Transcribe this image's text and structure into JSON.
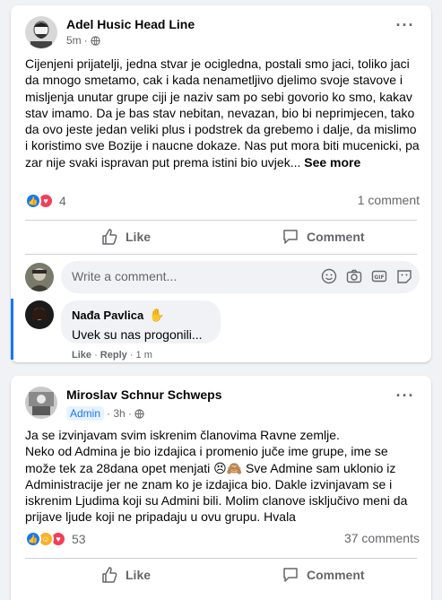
{
  "post1": {
    "author": "Adel Husic Head Line",
    "time": "5m",
    "body": "Cijenjeni prijatelji, jedna stvar je ocigledna, postali smo jaci, toliko jaci da mnogo smetamo, cak i kada nenametljivo djelimo svoje stavove i misljenja unutar grupe ciji je naziv sam po sebi govorio ko smo, kakav stav imamo. Da je bas stav nebitan, nevazan, bio bi neprimjecen, tako da ovo jeste jedan veliki plus i podstrek da grebemo i dalje, da mislimo i koristimo sve Bozije i naucne dokaze. Nas put mora biti mucenicki, pa zar nije svaki ispravan put prema istini bio uvjek...",
    "see_more": "See more",
    "reaction_count": "4",
    "comments_count": "1 comment",
    "like_label": "Like",
    "comment_label": "Comment",
    "write_placeholder": "Write a comment...",
    "comment": {
      "author": "Nađa Pavlica",
      "text": "Uvek su nas progonili...",
      "like": "Like",
      "sep": " · ",
      "reply": "Reply",
      "time": " · 1 m"
    }
  },
  "post2": {
    "author": "Miroslav Schnur Schweps",
    "badge": "Admin",
    "time": "· 3h ·",
    "body": "Ja se izvinjavam svim iskrenim članovima Ravne zemlje.\nNeko od Admina je bio izdajica i promenio juče ime grupe, ime se može tek za 28dana opet menjati 😣🙈 Sve Admine sam uklonio iz Administracije jer ne znam ko je izdajica bio. Dakle izvinjavam se i iskrenim Ljudima koji su Admini bili. Molim clanove isključivo meni da prijave ljude koji ne pripadaju u ovu grupu. Hvala",
    "reaction_count": "53",
    "comments_count": "37 comments",
    "like_label": "Like",
    "comment_label": "Comment"
  },
  "colors": {
    "accent": "#1877f2",
    "love": "#f33e58",
    "haha": "#f7b125",
    "muted": "#65676b"
  },
  "icons": [
    "globe-icon",
    "more-icon",
    "like-icon",
    "comment-icon",
    "emoji-icon",
    "camera-icon",
    "gif-icon",
    "sticker-icon",
    "wave-icon"
  ]
}
